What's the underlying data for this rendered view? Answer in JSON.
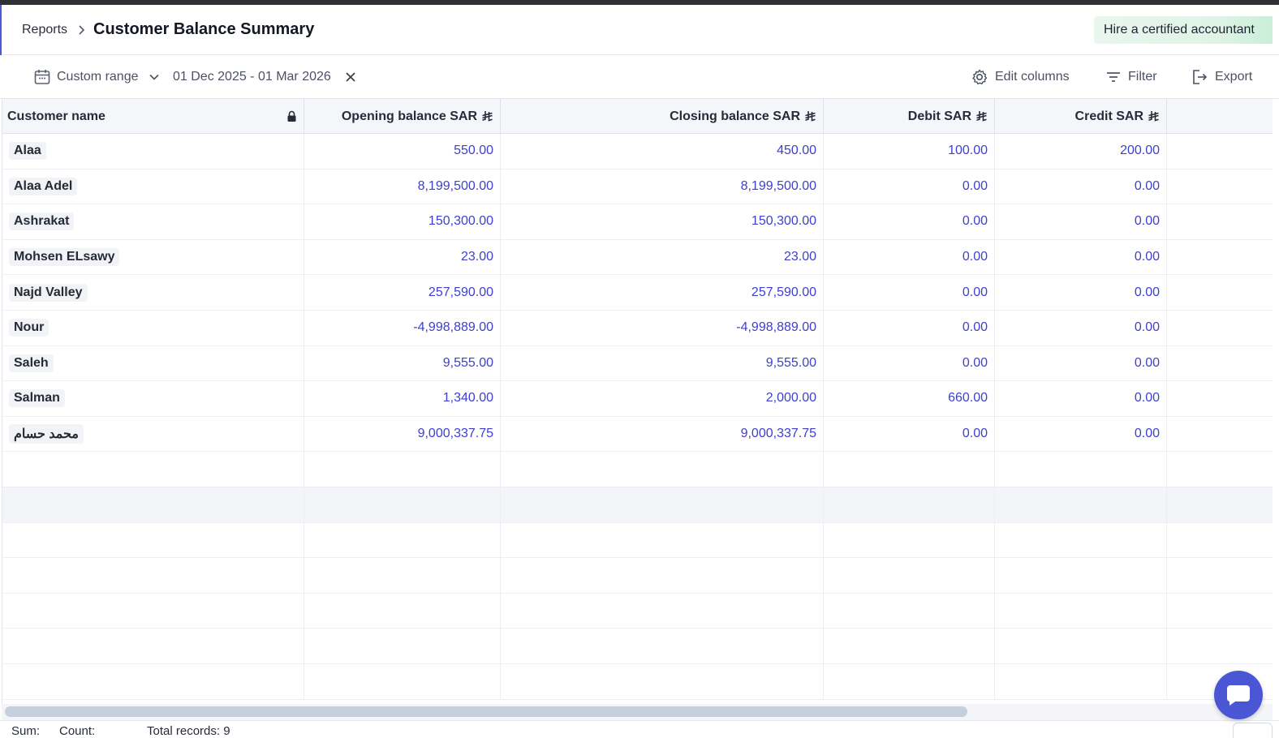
{
  "header": {
    "breadcrumb": "Reports",
    "title": "Customer Balance Summary",
    "hire_label": "Hire a certified accountant"
  },
  "toolbar": {
    "range_label": "Custom range",
    "date_range": "01 Dec 2025 - 01 Mar 2026",
    "edit_columns_label": "Edit columns",
    "filter_label": "Filter",
    "export_label": "Export"
  },
  "table": {
    "columns": [
      {
        "label": "Customer name"
      },
      {
        "label": "Opening balance  SAR"
      },
      {
        "label": "Closing balance  SAR"
      },
      {
        "label": "Debit  SAR"
      },
      {
        "label": "Credit  SAR"
      }
    ],
    "rows": [
      {
        "name": "Alaa",
        "opening": "550.00",
        "closing": "450.00",
        "debit": "100.00",
        "credit": "200.00"
      },
      {
        "name": "Alaa Adel",
        "opening": "8,199,500.00",
        "closing": "8,199,500.00",
        "debit": "0.00",
        "credit": "0.00"
      },
      {
        "name": "Ashrakat",
        "opening": "150,300.00",
        "closing": "150,300.00",
        "debit": "0.00",
        "credit": "0.00"
      },
      {
        "name": "Mohsen ELsawy",
        "opening": "23.00",
        "closing": "23.00",
        "debit": "0.00",
        "credit": "0.00"
      },
      {
        "name": "Najd Valley",
        "opening": "257,590.00",
        "closing": "257,590.00",
        "debit": "0.00",
        "credit": "0.00"
      },
      {
        "name": "Nour",
        "opening": "-4,998,889.00",
        "closing": "-4,998,889.00",
        "debit": "0.00",
        "credit": "0.00"
      },
      {
        "name": "Saleh",
        "opening": "9,555.00",
        "closing": "9,555.00",
        "debit": "0.00",
        "credit": "0.00"
      },
      {
        "name": "Salman",
        "opening": "1,340.00",
        "closing": "2,000.00",
        "debit": "660.00",
        "credit": "0.00"
      },
      {
        "name": "محمد حسام",
        "opening": "9,000,337.75",
        "closing": "9,000,337.75",
        "debit": "0.00",
        "credit": "0.00"
      }
    ]
  },
  "footer": {
    "sum_label": "Sum:",
    "count_label": "Count:",
    "total_records": "Total records: 9"
  },
  "colors": {
    "accent": "#4a56d4",
    "amount_text": "#3d3fd0",
    "hire_bg": "#dff3e6"
  }
}
